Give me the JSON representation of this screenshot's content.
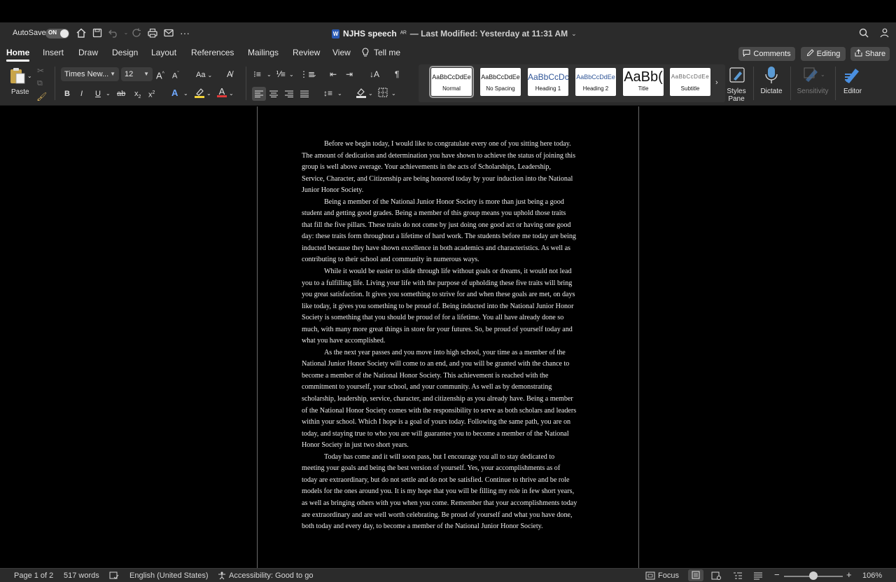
{
  "titlebar": {
    "autosave_label": "AutoSave",
    "autosave_state": "ON",
    "doc_title": "NJHS speech",
    "doc_modified": "— Last Modified: Yesterday at 11:31 AM",
    "icons": [
      "home-icon",
      "save-icon",
      "undo-icon",
      "redo-icon",
      "print-icon",
      "mail-icon",
      "more-icon",
      "search-icon",
      "share-people-icon"
    ]
  },
  "tabs": [
    "Home",
    "Insert",
    "Draw",
    "Design",
    "Layout",
    "References",
    "Mailings",
    "Review",
    "View"
  ],
  "tell_me": "Tell me",
  "actions": {
    "comments": "Comments",
    "editing": "Editing",
    "share": "Share"
  },
  "ribbon": {
    "paste": "Paste",
    "font_name": "Times New...",
    "font_size": "12",
    "font_case": "Aa",
    "styles": [
      {
        "sample": "AaBbCcDdEe",
        "name": "Normal"
      },
      {
        "sample": "AaBbCcDdEe",
        "name": "No Spacing"
      },
      {
        "sample": "AaBbCcDc",
        "name": "Heading 1"
      },
      {
        "sample": "AaBbCcDdEe",
        "name": "Heading 2"
      },
      {
        "sample": "AaBb(",
        "name": "Title"
      },
      {
        "sample": "AaBbCcDdEe",
        "name": "Subtitle"
      }
    ],
    "styles_pane": "Styles\nPane",
    "dictate": "Dictate",
    "sensitivity": "Sensitivity",
    "editor": "Editor"
  },
  "document": {
    "paragraphs": [
      [
        "Before we begin today, I would like to congratulate every one of you sitting here today.",
        "The amount of dedication and determination you have shown to achieve the status of joining this",
        "group is well above average.  Your achievements in the acts of Scholarships, Leadership,",
        "Service, Character, and Citizenship are being honored today by your induction into the National",
        "Junior Honor Society."
      ],
      [
        "Being a member of the National Junior Honor Society is more than just being a good",
        "student and getting good grades. Being a member of this group means you uphold those traits",
        "that fill the five pillars. These traits do not come by just doing one good act or having one good",
        "day: these traits form throughout a lifetime of hard work. The students before me today are being",
        "inducted because they have shown excellence in both academics and characteristics. As well as",
        "contributing to their school and community in numerous ways."
      ],
      [
        "While it would be easier to slide through life without goals or dreams, it would not lead",
        "you to a fulfilling life. Living your life with the purpose of upholding these five traits will bring",
        "you great satisfaction. It gives you something to strive for and when these goals are met, on days",
        "like today, it gives you something to be proud of. Being inducted into the National Junior Honor",
        "Society is something that you should be proud of for a lifetime. You all have already done so",
        "much, with many more great things in store for your futures. So, be proud of yourself today and",
        "what you have accomplished."
      ],
      [
        "As the next year passes and you move into high school, your time as a member of the",
        "National Junior Honor Society will come to an end, and you will be granted with the chance to",
        "become a member of the National Honor Society.  This achievement is reached with the",
        "commitment to yourself, your school, and your community. As well as by demonstrating",
        "scholarship, leadership, service, character, and citizenship as you already have. Being a member",
        "of the National Honor Society comes with the responsibility to serve as both scholars and leaders",
        "within your school. Which I hope is a goal of yours today. Following the same path, you are on",
        "today, and staying true to who you are will guarantee you to become a member of the National",
        "Honor Society in just two short years."
      ],
      [
        "Today has come and it will soon pass, but I encourage you all to stay dedicated to",
        "meeting your goals and being the best version of yourself. Yes, your accomplishments as of",
        "today are extraordinary, but do not settle and do not be satisfied. Continue to thrive and be role",
        "models for the ones around you. It is my hope that you will be filling my role in few short years,",
        "as well as bringing others with you when you come. Remember that your accomplishments today",
        "are extraordinary and are well worth celebrating. Be proud of yourself and what you have done,",
        "both today and every day, to become a member of the National Junior Honor Society."
      ]
    ]
  },
  "status": {
    "page": "Page 1 of 2",
    "words": "517 words",
    "language": "English (United States)",
    "accessibility": "Accessibility: Good to go",
    "focus": "Focus",
    "zoom": "106%"
  }
}
